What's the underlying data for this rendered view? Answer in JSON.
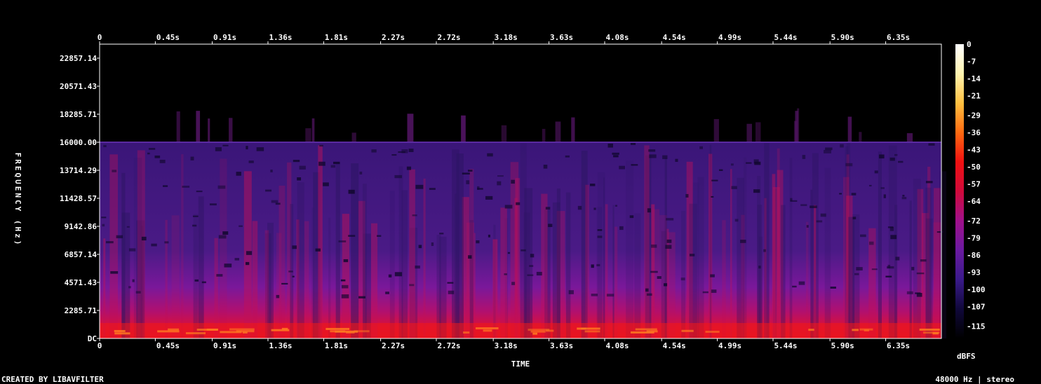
{
  "chart_data": {
    "type": "heatmap",
    "title": "",
    "xlabel": "TIME",
    "ylabel": "FREQUENCY (Hz)",
    "x_tick_labels": [
      "0",
      "0.45s",
      "0.91s",
      "1.36s",
      "1.81s",
      "2.27s",
      "2.72s",
      "3.18s",
      "3.63s",
      "4.08s",
      "4.54s",
      "4.99s",
      "5.44s",
      "5.90s",
      "6.35s"
    ],
    "x_tick_values": [
      0,
      0.45,
      0.91,
      1.36,
      1.81,
      2.27,
      2.72,
      3.18,
      3.63,
      4.08,
      4.54,
      4.99,
      5.44,
      5.9,
      6.35
    ],
    "xlim": [
      0,
      6.8
    ],
    "y_tick_labels": [
      "DC",
      "2285.71",
      "4571.43",
      "6857.14",
      "9142.86",
      "11428.57",
      "13714.29",
      "16000.00",
      "18285.71",
      "20571.43",
      "22857.14"
    ],
    "y_tick_values": [
      0,
      2285.71,
      4571.43,
      6857.14,
      9142.86,
      11428.57,
      13714.29,
      16000.0,
      18285.71,
      20571.43,
      22857.14
    ],
    "ylim": [
      0,
      24000
    ],
    "colorbar": {
      "unit": "dBFS",
      "labels": [
        "0",
        "-7",
        "-14",
        "-21",
        "-29",
        "-36",
        "-43",
        "-50",
        "-57",
        "-64",
        "-72",
        "-79",
        "-86",
        "-93",
        "-100",
        "-107",
        "-115"
      ],
      "values": [
        0,
        -7,
        -14,
        -21,
        -29,
        -36,
        -43,
        -50,
        -57,
        -64,
        -72,
        -79,
        -86,
        -93,
        -100,
        -107,
        -115
      ],
      "range": [
        -120,
        0
      ],
      "colors": [
        "#000000",
        "#10083a",
        "#3a1a8a",
        "#6a1aa0",
        "#a0108a",
        "#d00a3a",
        "#f01010",
        "#ff6a10",
        "#ffc040",
        "#fff4b0",
        "#ffffff"
      ]
    },
    "spectrum_cutoff_hz": 16000,
    "grid": false
  },
  "footer": {
    "created_by": "CREATED BY LIBAVFILTER",
    "format": "48000 Hz | stereo"
  }
}
